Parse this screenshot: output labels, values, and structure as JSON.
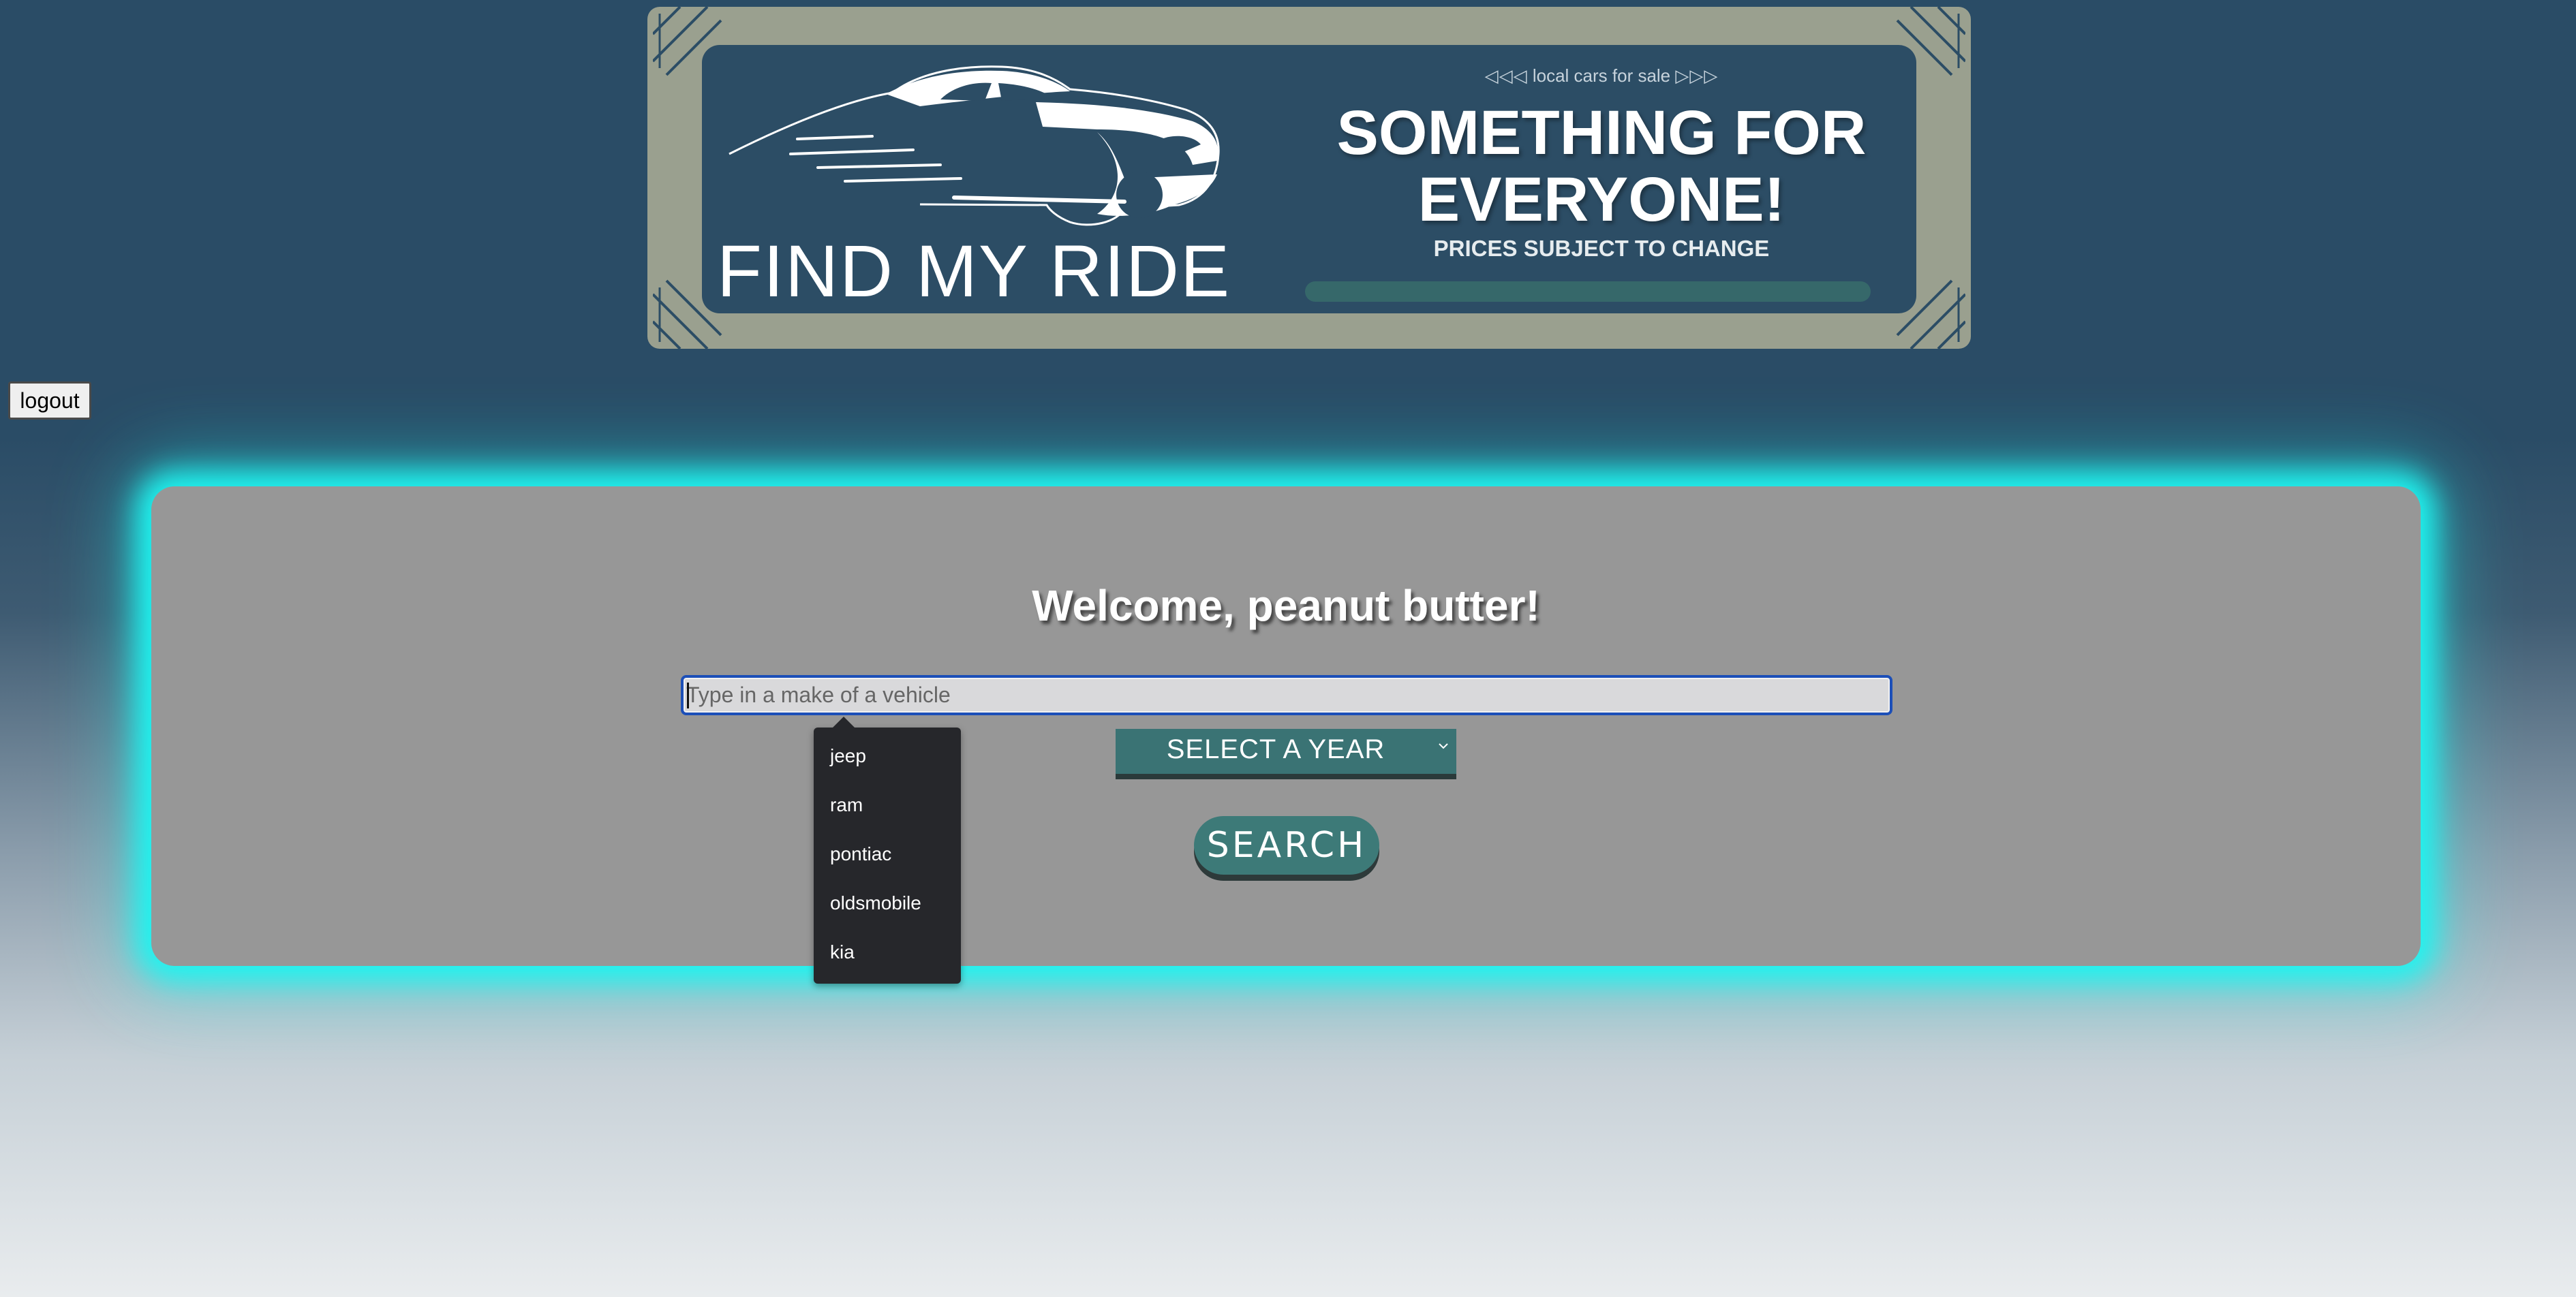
{
  "banner": {
    "logo_text": "FIND MY RIDE",
    "tagline_left_arrows": "◁◁◁",
    "tagline": "local cars for sale",
    "tagline_right_arrows": "▷▷▷",
    "headline_line1": "SOMETHING FOR",
    "headline_line2": "EVERYONE!",
    "subline": "PRICES SUBJECT TO CHANGE",
    "colors": {
      "frame": "#9aa08f",
      "panel": "#2c4d65",
      "accent_bar": "#36686a"
    }
  },
  "header": {
    "logout_label": "logout"
  },
  "main": {
    "welcome": "Welcome, peanut butter!",
    "search": {
      "value": "",
      "placeholder": "Type in a make of a vehicle"
    },
    "year_select": {
      "selected": "SELECT A YEAR"
    },
    "search_button_label": "SEARCH",
    "suggestions": [
      "jeep",
      "ram",
      "pontiac",
      "oldsmobile",
      "kia"
    ],
    "colors": {
      "card_bg": "#979797",
      "glow": "#1ff4f0",
      "button": "#3d7a78",
      "dropdown_bg": "#26272b"
    }
  },
  "page": {
    "background_top": "#2a4c66",
    "background_bottom": "#e9ecee"
  }
}
